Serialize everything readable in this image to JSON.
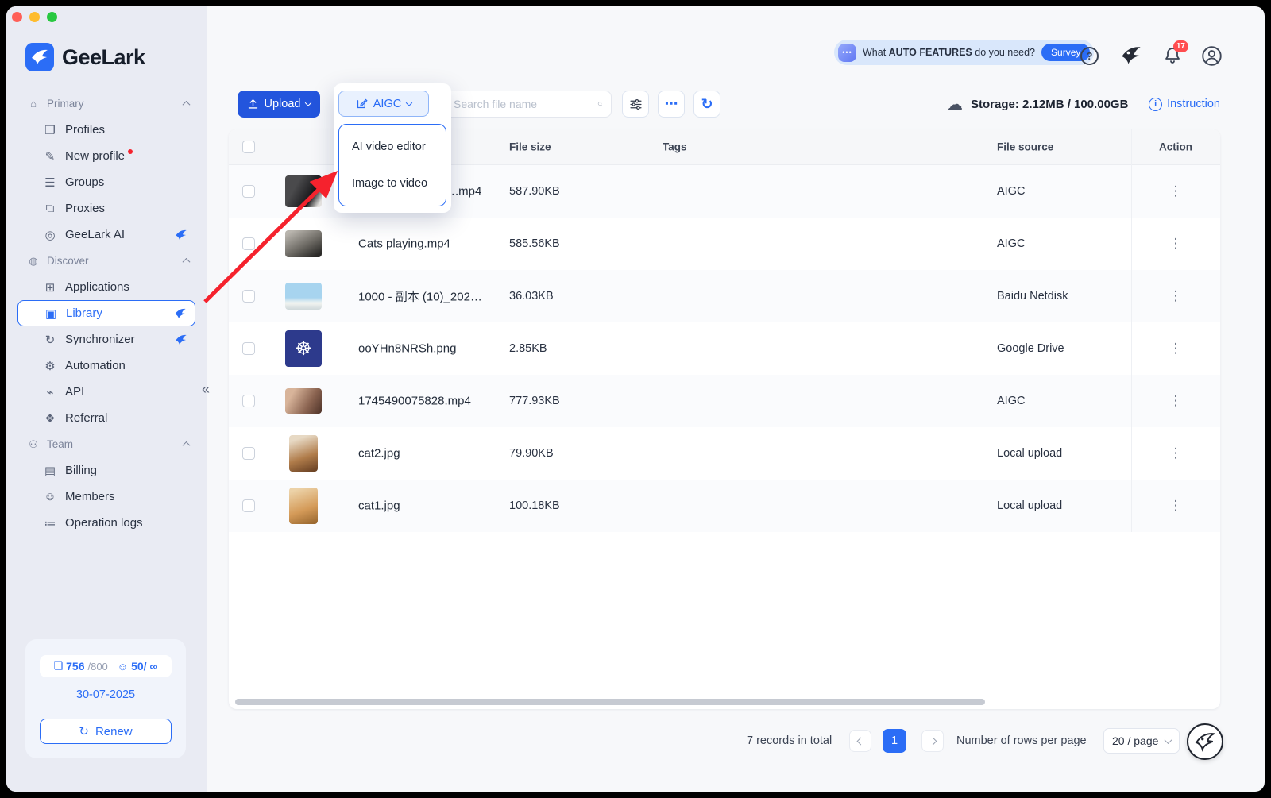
{
  "colors": {
    "accent": "#2b6df6",
    "upload_button": "#2355dd",
    "arrow_red": "#f5222d",
    "badge_red": "#ff4d4f",
    "sidebar_bg": "#e9ebf3"
  },
  "sidebar": {
    "logo_text": "GeeLark",
    "sections": [
      {
        "label": "Primary",
        "items": [
          {
            "label": "Profiles"
          },
          {
            "label": "New profile"
          },
          {
            "label": "Groups"
          },
          {
            "label": "Proxies"
          },
          {
            "label": "GeeLark AI"
          }
        ]
      },
      {
        "label": "Discover",
        "items": [
          {
            "label": "Applications"
          },
          {
            "label": "Library"
          },
          {
            "label": "Synchronizer"
          },
          {
            "label": "Automation"
          },
          {
            "label": "API"
          },
          {
            "label": "Referral"
          }
        ]
      },
      {
        "label": "Team",
        "items": [
          {
            "label": "Billing"
          },
          {
            "label": "Members"
          },
          {
            "label": "Operation logs"
          }
        ]
      }
    ],
    "plan": {
      "profiles_used": "756",
      "profiles_limit": "/800",
      "members_used": "50/",
      "members_limit": "∞",
      "expiry_date": "30-07-2025",
      "renew_label": "Renew"
    }
  },
  "topbar": {
    "survey_prefix": "What ",
    "survey_bold": "AUTO FEATURES",
    "survey_suffix": " do you need?",
    "survey_button": "Survey",
    "notification_count": "17"
  },
  "toolbar": {
    "upload_label": "Upload",
    "aigc_label": "AIGC",
    "search_placeholder": "Search file name",
    "storage_text": "Storage: 2.12MB / 100.00GB",
    "instruction_label": "Instruction"
  },
  "aigc_menu": {
    "items": [
      {
        "label": "AI video editor"
      },
      {
        "label": "Image to video"
      }
    ]
  },
  "table": {
    "headers": {
      "file_size": "File size",
      "tags": "Tags",
      "file_source": "File source",
      "action": "Action"
    },
    "rows": [
      {
        "name": "….mp4",
        "size": "587.90KB",
        "tags": "",
        "source": "AIGC"
      },
      {
        "name": "Cats playing.mp4",
        "size": "585.56KB",
        "tags": "",
        "source": "AIGC"
      },
      {
        "name": "1000 - 副本 (10)_202…",
        "size": "36.03KB",
        "tags": "",
        "source": "Baidu Netdisk"
      },
      {
        "name": "ooYHn8NRSh.png",
        "size": "2.85KB",
        "tags": "",
        "source": "Google Drive"
      },
      {
        "name": "1745490075828.mp4",
        "size": "777.93KB",
        "tags": "",
        "source": "AIGC"
      },
      {
        "name": "cat2.jpg",
        "size": "79.90KB",
        "tags": "",
        "source": "Local upload"
      },
      {
        "name": "cat1.jpg",
        "size": "100.18KB",
        "tags": "",
        "source": "Local upload"
      }
    ]
  },
  "pagination": {
    "total_text": "7 records in total",
    "current_page": "1",
    "rows_label": "Number of rows per page",
    "page_size": "20 / page"
  }
}
